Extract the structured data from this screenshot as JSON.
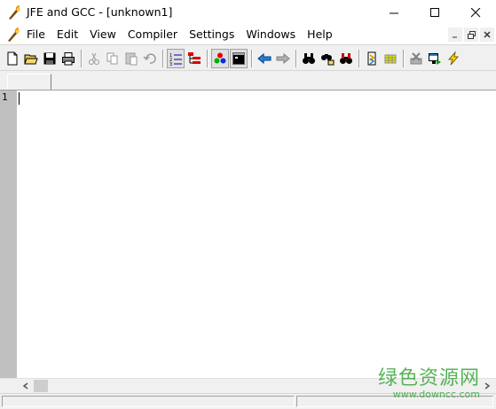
{
  "window": {
    "title": "JFE and GCC - [unknown1]"
  },
  "menu": {
    "items": [
      "File",
      "Edit",
      "View",
      "Compiler",
      "Settings",
      "Windows",
      "Help"
    ]
  },
  "editor": {
    "line_numbers": [
      "1"
    ]
  },
  "watermark": {
    "text": "绿色资源网",
    "url": "www.downcc.com"
  },
  "colors": {
    "gutter": "#c0c0c0",
    "chrome": "#f0f0f0",
    "watermark": "#3aa83a"
  }
}
